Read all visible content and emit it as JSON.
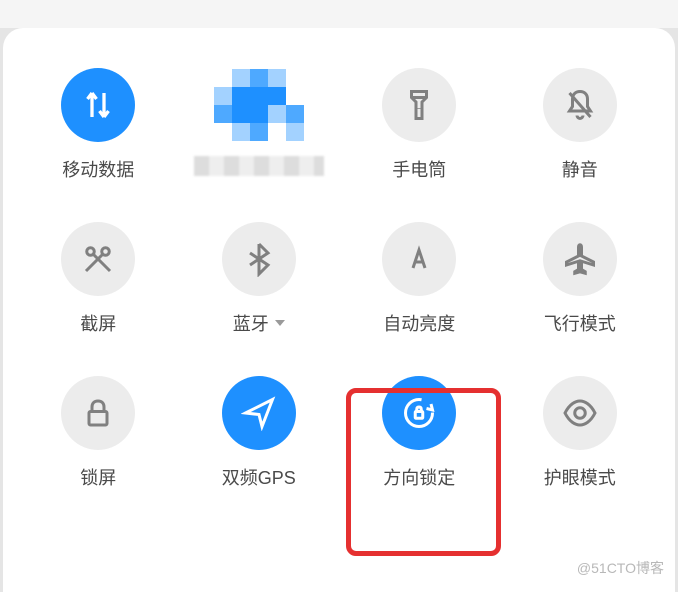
{
  "tiles": {
    "mobile_data": {
      "label": "移动数据",
      "active": true,
      "icon": "data-arrows-icon"
    },
    "wifi": {
      "label": "",
      "active": true,
      "icon": "wifi-icon",
      "obscured": true
    },
    "flashlight": {
      "label": "手电筒",
      "active": false,
      "icon": "flashlight-icon"
    },
    "mute": {
      "label": "静音",
      "active": false,
      "icon": "mute-icon"
    },
    "screenshot": {
      "label": "截屏",
      "active": false,
      "icon": "scissors-icon"
    },
    "bluetooth": {
      "label": "蓝牙",
      "active": false,
      "icon": "bluetooth-icon",
      "has_chevron": true
    },
    "auto_brightness": {
      "label": "自动亮度",
      "active": false,
      "icon": "auto-brightness-icon"
    },
    "airplane": {
      "label": "飞行模式",
      "active": false,
      "icon": "airplane-icon"
    },
    "lock_screen": {
      "label": "锁屏",
      "active": false,
      "icon": "lock-icon"
    },
    "dual_gps": {
      "label": "双频GPS",
      "active": true,
      "icon": "gps-icon"
    },
    "rotation_lock": {
      "label": "方向锁定",
      "active": true,
      "icon": "rotation-lock-icon",
      "highlighted": true
    },
    "eye_care": {
      "label": "护眼模式",
      "active": false,
      "icon": "eye-icon"
    }
  },
  "watermark": "@51CTO博客"
}
